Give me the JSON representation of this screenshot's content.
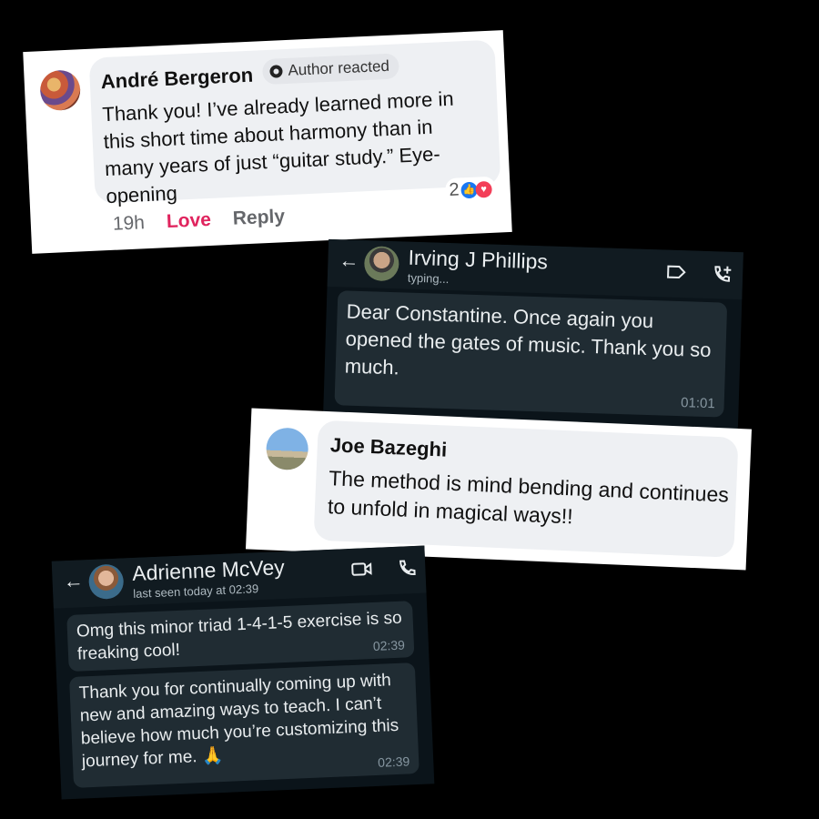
{
  "card1": {
    "name": "André Bergeron",
    "author_reacted": "Author reacted",
    "text": "Thank you! I’ve already learned more in this short time about harmony than in many years of just “guitar study.” Eye-opening",
    "reaction_count": "2",
    "time": "19h",
    "love": "Love",
    "reply": "Reply",
    "colors": {
      "love": "#e0245e",
      "like_icon": "#1877f2",
      "love_icon": "#f33e58"
    }
  },
  "card2": {
    "back": "←",
    "name": "Irving J Phillips",
    "status": "typing...",
    "message": "Dear Constantine. Once again you opened the gates of music. Thank you so much.",
    "time": "01:01"
  },
  "card3": {
    "name": "Joe Bazeghi",
    "text": "The method is mind bending and continues to unfold in magical ways!!"
  },
  "card4": {
    "back": "←",
    "name": "Adrienne McVey",
    "status": "last seen today at 02:39",
    "messages": [
      {
        "text": "Omg this minor triad 1-4-1-5 exercise is so freaking cool!",
        "time": "02:39"
      },
      {
        "text": "Thank you for continually coming up with new and amazing ways to teach. I can’t believe how much you’re customizing this journey for me. 🙏",
        "time": "02:39"
      }
    ]
  },
  "icons": [
    "label-icon",
    "add-call-icon",
    "video-call-icon",
    "phone-icon",
    "like-icon",
    "love-icon",
    "back-arrow-icon"
  ]
}
